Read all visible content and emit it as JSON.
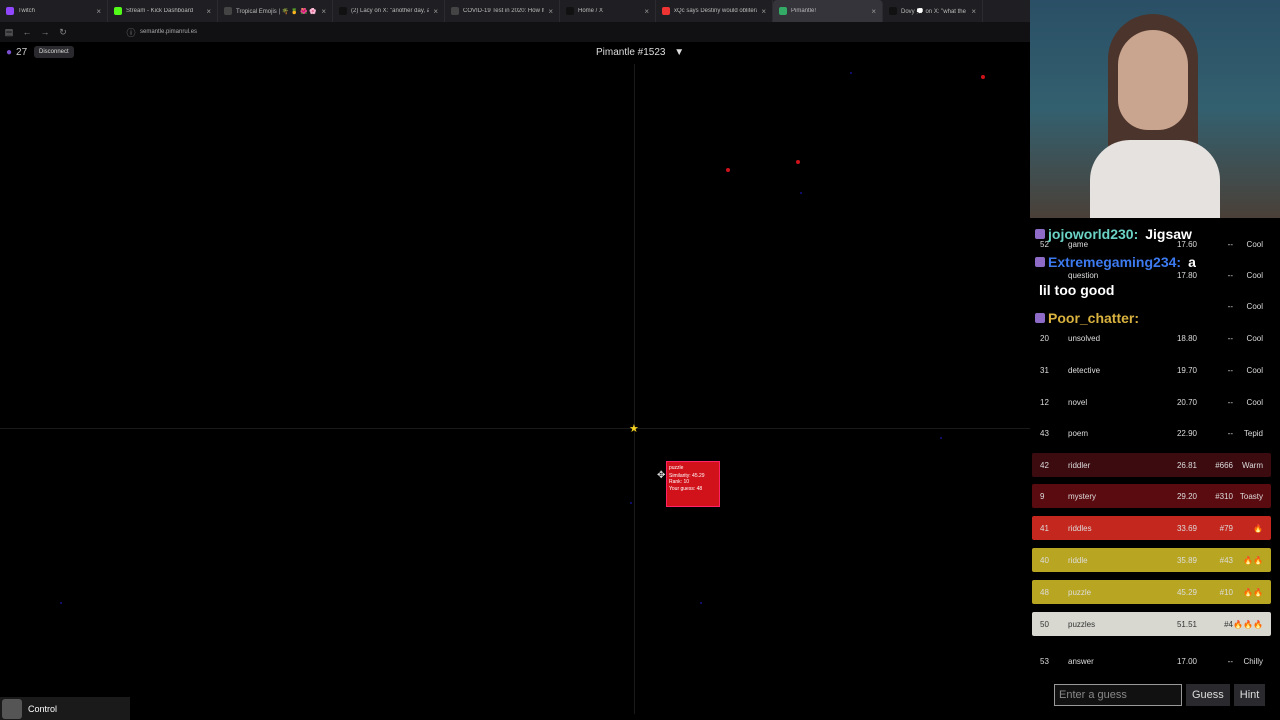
{
  "browser": {
    "tabs": [
      {
        "title": "Twitch",
        "color": "#9146ff"
      },
      {
        "title": "Stream - Kick Dashboard",
        "color": "#53fc18"
      },
      {
        "title": "Tropical Emojis | 🌴 🍍 🌺 🌸 🦜 🍹 🏖",
        "color": "#444"
      },
      {
        "title": "(2) Lacy on X: \"another day, an",
        "color": "#111"
      },
      {
        "title": "COVID-19 Test in 2020: How It",
        "color": "#444"
      },
      {
        "title": "Home / X",
        "color": "#111"
      },
      {
        "title": "xQc says Destiny would oblitera",
        "color": "#e33"
      },
      {
        "title": "Pimantle!",
        "color": "#3a6"
      },
      {
        "title": "Dovy 💭 on X: \"what the actual",
        "color": "#111"
      }
    ],
    "url": "semantle.pimanrul.es"
  },
  "game": {
    "counter": "27",
    "disconnect_label": "Disconnect",
    "title": "Pimantle #1523",
    "title_caret": "▼",
    "tooltip": {
      "word": "puzzle",
      "similarity": "Similarity: 45.29",
      "rank": "Rank: 10",
      "guess": "Your guess: 48"
    },
    "control_label": "Control"
  },
  "chat": [
    {
      "user": "jojoworld230:",
      "msg": "Jigsaw",
      "color": "#6ad3c5"
    },
    {
      "user": "Extremegaming234:",
      "msg": "a",
      "color": "#3d7af0"
    },
    {
      "user": "",
      "msg": "lil too good",
      "color": "#fff"
    },
    {
      "user": "Poor_chatter:",
      "msg": "",
      "color": "#d9b23f"
    }
  ],
  "guesses": [
    {
      "n": "52",
      "w": "game",
      "s": "17.60",
      "r": "--",
      "t": "Cool",
      "bg": "transparent"
    },
    {
      "n": "",
      "w": "question",
      "s": "17.80",
      "r": "--",
      "t": "Cool",
      "bg": "transparent"
    },
    {
      "n": "",
      "w": "",
      "s": "",
      "r": "--",
      "t": "Cool",
      "bg": "transparent"
    },
    {
      "n": "20",
      "w": "unsolved",
      "s": "18.80",
      "r": "--",
      "t": "Cool",
      "bg": "transparent"
    },
    {
      "n": "31",
      "w": "detective",
      "s": "19.70",
      "r": "--",
      "t": "Cool",
      "bg": "transparent"
    },
    {
      "n": "12",
      "w": "novel",
      "s": "20.70",
      "r": "--",
      "t": "Cool",
      "bg": "transparent"
    },
    {
      "n": "43",
      "w": "poem",
      "s": "22.90",
      "r": "--",
      "t": "Tepid",
      "bg": "transparent"
    },
    {
      "n": "42",
      "w": "riddler",
      "s": "26.81",
      "r": "#666",
      "t": "Warm",
      "bg": "#3b0b10"
    },
    {
      "n": "9",
      "w": "mystery",
      "s": "29.20",
      "r": "#310",
      "t": "Toasty",
      "bg": "#5a0b10"
    },
    {
      "n": "41",
      "w": "riddles",
      "s": "33.69",
      "r": "#79",
      "t": "🔥",
      "bg": "#c3271d"
    },
    {
      "n": "40",
      "w": "riddle",
      "s": "35.89",
      "r": "#43",
      "t": "🔥🔥",
      "bg": "#b8a521"
    },
    {
      "n": "48",
      "w": "puzzle",
      "s": "45.29",
      "r": "#10",
      "t": "🔥🔥",
      "bg": "#b8a521"
    },
    {
      "n": "50",
      "w": "puzzles",
      "s": "51.51",
      "r": "#4",
      "t": "🔥🔥🔥",
      "bg": "#d8d8d0"
    },
    {
      "n": "53",
      "w": "answer",
      "s": "17.00",
      "r": "--",
      "t": "Chilly",
      "bg": "transparent"
    }
  ],
  "input": {
    "placeholder": "Enter a guess",
    "guess_label": "Guess",
    "hint_label": "Hint"
  }
}
